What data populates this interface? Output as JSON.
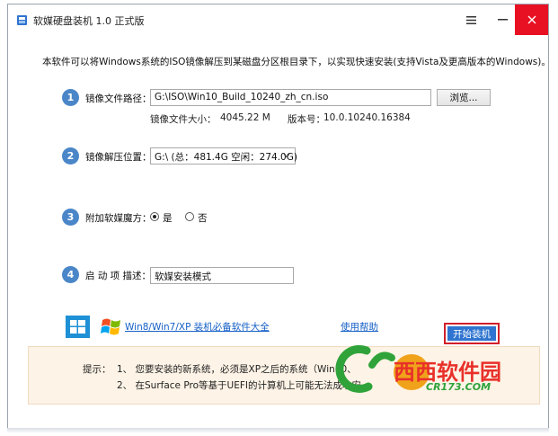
{
  "window": {
    "title": "软媒硬盘装机 1.0 正式版",
    "menu_icon": "hamburger-icon",
    "minimize_icon": "minimize-icon",
    "close_icon": "close-icon",
    "close_color": "#e81123"
  },
  "intro_text": "本软件可以将Windows系统的ISO镜像解压到某磁盘分区根目录下，以实现快速安装(支持Vista及更高版本的Windows)。",
  "steps": {
    "s1": {
      "number": "1",
      "label": "镜像文件路径：",
      "path_value": "G:\\ISO\\Win10_Build_10240_zh_cn.iso",
      "browse_label": "浏览..."
    },
    "s1_info": {
      "size_label": "镜像文件大小：",
      "size_value": "4045.22 M",
      "version_label": "版本号：",
      "version_value": "10.0.10240.16384"
    },
    "s2": {
      "number": "2",
      "label": "镜像解压位置：",
      "drive_value": "G:\\ (总：481.4G 空闲：274.0G)"
    },
    "s3": {
      "number": "3",
      "label": "附加软媒魔方：",
      "option_yes": "是",
      "option_no": "否",
      "selected": "是"
    },
    "s4": {
      "number": "4",
      "label": "启 动 项 描述：",
      "desc_value": "软媒安装模式"
    }
  },
  "footer": {
    "win_link": "Win8/Win7/XP 装机必备软件大全",
    "help_link": "使用帮助",
    "start_button": "开始装机"
  },
  "tips": {
    "label": "提示：",
    "line1": "1、 您要安装的新系统，必须是XP之后的系统（Win10、",
    "line2": "2、 在Surface Pro等基于UEFI的计算机上可能无法成功安"
  },
  "watermark": {
    "brand": "西西软件园",
    "domain": "CR173.COM"
  },
  "colors": {
    "accent": "#4a86c8",
    "link": "#1660c6",
    "start_button": "#2f74d0",
    "highlight_border": "#d0202a",
    "tips_bg": "#fdf3e6"
  }
}
